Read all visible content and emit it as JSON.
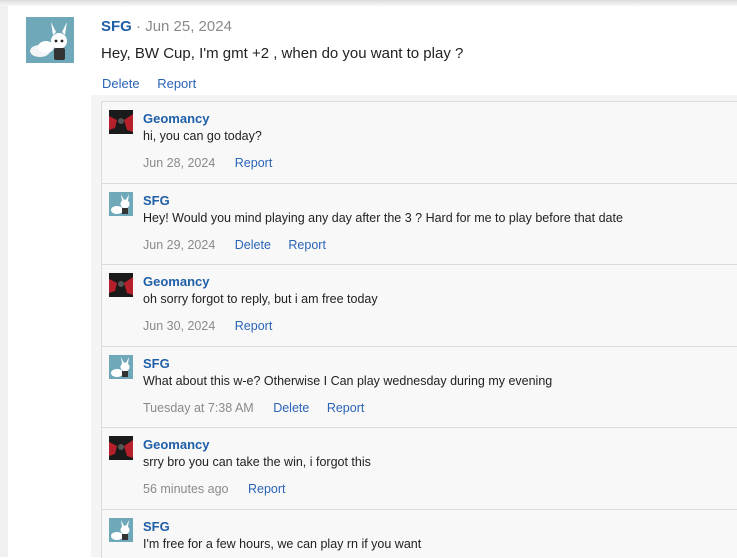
{
  "main_post": {
    "author": "SFG",
    "separator": "·",
    "date": "Jun 25, 2024",
    "text": "Hey, BW Cup, I'm gmt +2 , when do you want to play ?",
    "actions": [
      "Delete",
      "Report"
    ]
  },
  "replies": [
    {
      "author": "Geomancy",
      "text": "hi, you can go today?",
      "date": "Jun 28, 2024",
      "actions": [
        "Report"
      ],
      "avatar": "geomancy"
    },
    {
      "author": "SFG",
      "text": "Hey! Would you mind playing any day after the 3 ? Hard for me to play before that date",
      "date": "Jun 29, 2024",
      "actions": [
        "Delete",
        "Report"
      ],
      "avatar": "sfg"
    },
    {
      "author": "Geomancy",
      "text": "oh sorry forgot to reply, but i am free today",
      "date": "Jun 30, 2024",
      "actions": [
        "Report"
      ],
      "avatar": "geomancy"
    },
    {
      "author": "SFG",
      "text": "What about this w-e? Otherwise I Can play wednesday during my evening",
      "date": "Tuesday at 7:38 AM",
      "actions": [
        "Delete",
        "Report"
      ],
      "avatar": "sfg"
    },
    {
      "author": "Geomancy",
      "text": "srry bro you can take the win, i forgot this",
      "date": "56 minutes ago",
      "actions": [
        "Report"
      ],
      "avatar": "geomancy"
    },
    {
      "author": "SFG",
      "text": "I'm free for a few hours, we can play rn if you want",
      "date": "",
      "actions": [],
      "avatar": "sfg"
    }
  ],
  "colors": {
    "link": "#2a64b6",
    "author": "#1f5fa8",
    "muted": "#8a8a8a",
    "sfg_avatar_bg": "#6fa8b8",
    "geomancy_avatar_bg": "#1a1a1a"
  }
}
